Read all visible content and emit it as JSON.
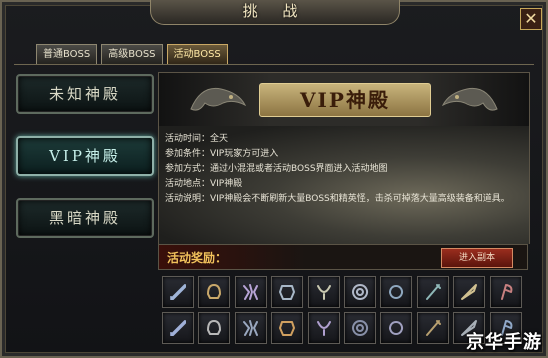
{
  "window": {
    "title": "挑 战",
    "close_label": "✕"
  },
  "tabs": [
    {
      "label": "普通BOSS",
      "active": false
    },
    {
      "label": "高级BOSS",
      "active": false
    },
    {
      "label": "活动BOSS",
      "active": true
    }
  ],
  "menu": [
    {
      "label": "未知神殿",
      "active": false
    },
    {
      "label": "VIP神殿",
      "active": true
    },
    {
      "label": "黑暗神殿",
      "active": false
    }
  ],
  "banner": {
    "title": "VIP神殿"
  },
  "info": {
    "time": "活动时间：全天",
    "condition": "参加条件：VIP玩家方可进入",
    "method": "参加方式：通过小混混或者活动BOSS界面进入活动地图",
    "location": "活动地点：VIP神殿",
    "description": "活动说明：VIP神殿会不断刷新大量BOSS和精英怪，击杀可掉落大量高级装备和道具。"
  },
  "reward": {
    "label": "活动奖励：",
    "enter_button": "进入副本"
  },
  "reward_items": [
    {
      "icon": "sword-icon",
      "color": "#9fb4d8"
    },
    {
      "icon": "helmet-icon",
      "color": "#c9a86a"
    },
    {
      "icon": "claw-icon",
      "color": "#b7a4d6"
    },
    {
      "icon": "armor-icon",
      "color": "#a8b8c8"
    },
    {
      "icon": "necklace-icon",
      "color": "#c8c8b0"
    },
    {
      "icon": "bracelet-icon",
      "color": "#b0b8c8"
    },
    {
      "icon": "ring-icon",
      "color": "#8fa8c0"
    },
    {
      "icon": "staff-icon",
      "color": "#8fb8b8"
    },
    {
      "icon": "blade-icon",
      "color": "#d0c090"
    },
    {
      "icon": "axe-icon",
      "color": "#c88080"
    },
    {
      "icon": "dagger-icon",
      "color": "#a0b0d8"
    },
    {
      "icon": "cuff-icon",
      "color": "#b8b8b8"
    },
    {
      "icon": "gauntlet-icon",
      "color": "#9aa8c0"
    },
    {
      "icon": "gem-ring-icon",
      "color": "#d0a060"
    },
    {
      "icon": "wand-icon",
      "color": "#b0a0d0"
    },
    {
      "icon": "boots-icon",
      "color": "#8890a8"
    },
    {
      "icon": "belt-icon",
      "color": "#a0a0c0"
    },
    {
      "icon": "bow-icon",
      "color": "#b8a070"
    },
    {
      "icon": "shield-icon",
      "color": "#a8b0b8"
    },
    {
      "icon": "spear-icon",
      "color": "#90a8c8"
    }
  ],
  "watermark": "京华手游"
}
